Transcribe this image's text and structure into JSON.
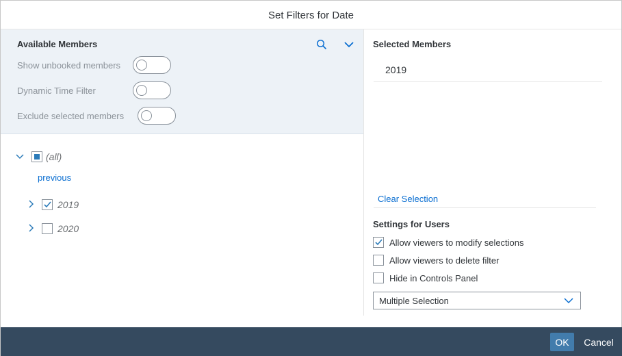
{
  "dialog": {
    "title": "Set Filters for Date"
  },
  "available": {
    "title": "Available Members",
    "search_icon": "search-icon",
    "expand_icon": "chevron-down-icon",
    "toggles": [
      {
        "label": "Show unbooked members",
        "on": false
      },
      {
        "label": "Dynamic Time Filter",
        "on": false
      },
      {
        "label": "Exclude selected members",
        "on": false
      }
    ],
    "tree": {
      "root_label": "(all)",
      "root_state": "partial",
      "previous_link": "previous",
      "items": [
        {
          "label": "2019",
          "checked": true
        },
        {
          "label": "2020",
          "checked": false
        }
      ]
    }
  },
  "selected": {
    "title": "Selected Members",
    "items": [
      "2019"
    ],
    "clear_label": "Clear Selection"
  },
  "settings": {
    "title": "Settings for Users",
    "options": [
      {
        "label": "Allow viewers to modify selections",
        "checked": true
      },
      {
        "label": "Allow viewers to delete filter",
        "checked": false
      },
      {
        "label": "Hide in Controls Panel",
        "checked": false
      }
    ],
    "selection_mode": "Multiple Selection"
  },
  "footer": {
    "ok_label": "OK",
    "cancel_label": "Cancel"
  },
  "colors": {
    "accent": "#0a6ed1",
    "panel_bg": "#edf2f7",
    "footer_bg": "#354a5f",
    "ok_bg": "#427cac"
  }
}
